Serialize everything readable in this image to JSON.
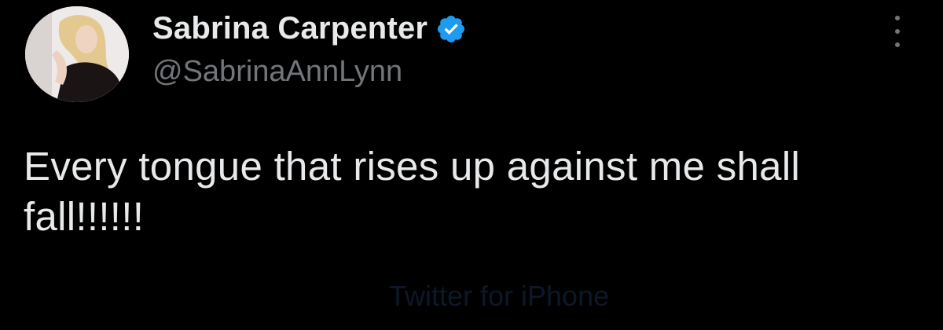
{
  "tweet": {
    "author": {
      "display_name": "Sabrina Carpenter",
      "handle": "@SabrinaAnnLynn",
      "verified": true,
      "verified_icon": "verified-badge-icon",
      "avatar_icon": "profile-photo"
    },
    "text": "Every tongue that rises up against me shall fall!!!!!!",
    "source": "Twitter for iPhone",
    "more_icon": "more-options-icon"
  },
  "colors": {
    "background": "#000000",
    "text_primary": "#e7e9ea",
    "text_secondary": "#71767b",
    "verified_blue": "#1d9bf0",
    "source_faded": "#0c1828"
  }
}
